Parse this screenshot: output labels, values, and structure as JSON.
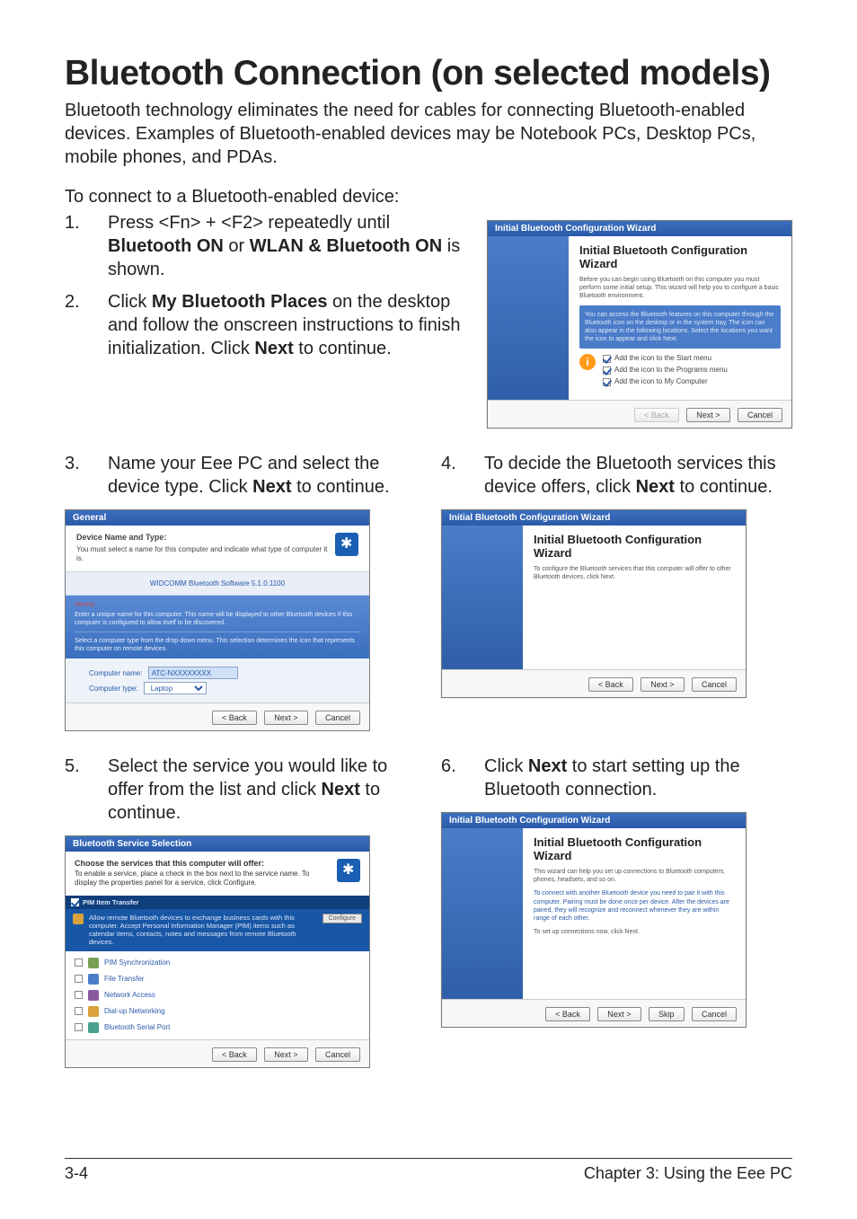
{
  "heading": "Bluetooth Connection (on selected models)",
  "intro": "Bluetooth technology eliminates the need for cables for connecting Bluetooth-enabled devices. Examples of Bluetooth-enabled devices may be Notebook PCs, Desktop PCs, mobile phones, and PDAs.",
  "lead": "To connect to a Bluetooth-enabled device:",
  "steps": {
    "s1_num": "1.",
    "s1_a": "Press <Fn> + <F2> repeatedly until ",
    "s1_b1": "Bluetooth ON",
    "s1_mid": " or ",
    "s1_b2": "WLAN & Bluetooth ON",
    "s1_c": " is shown.",
    "s2_num": "2.",
    "s2_a": "Click ",
    "s2_b": "My Bluetooth Places",
    "s2_c": " on the desktop and follow the onscreen instructions to finish initialization. Click ",
    "s2_d": "Next",
    "s2_e": " to continue.",
    "s3_num": "3.",
    "s3_a": "Name your Eee PC and select the device type. Click ",
    "s3_b": "Next",
    "s3_c": " to continue.",
    "s4_num": "4.",
    "s4_a": "To decide the Bluetooth services this device offers, click ",
    "s4_b": "Next",
    "s4_c": " to continue.",
    "s5_num": "5.",
    "s5_a": "Select the service you would like to offer from the list and click ",
    "s5_b": "Next",
    "s5_c": " to continue.",
    "s6_num": "6.",
    "s6_a": "Click ",
    "s6_b": "Next",
    "s6_c": " to start setting up the Bluetooth connection."
  },
  "wizard": {
    "titlebar": "Initial Bluetooth Configuration Wizard",
    "h": "Initial Bluetooth Configuration Wizard",
    "p1": "Before you can begin using Bluetooth on this computer you must perform some initial setup. This wizard will help you to configure a basic Bluetooth environment.",
    "bluebox": "You can access the Bluetooth features on this computer through the Bluetooth icon on the desktop or in the system tray. The icon can also appear in the following locations. Select the locations you want the icon to appear and click Next.",
    "check1": "Add the icon to the Start menu",
    "check2": "Add the icon to the Programs menu",
    "check3": "Add the icon to My Computer",
    "btn_back": "< Back",
    "btn_next": "Next >",
    "btn_cancel": "Cancel"
  },
  "wizard3": {
    "titlebar": "General",
    "group": "Device Name and Type:",
    "desc": "You must select a name for this computer and indicate what type of computer it is.",
    "section": "WIDCOMM Bluetooth Software 5.1.0.1100",
    "blue1": "Enter a unique name for this computer. This name will be displayed to other Bluetooth devices if this computer is configured to allow itself to be discovered.",
    "blue2": "Select a computer type from the drop-down menu. This selection determines the icon that represents this computer on remote devices.",
    "label_name": "Computer name:",
    "value_name": "ATC-NXXXXXXXX",
    "label_type": "Computer type:",
    "value_type": "Laptop"
  },
  "wizard4": {
    "h": "Initial Bluetooth Configuration Wizard",
    "p": "To configure the Bluetooth services that this computer will offer to other Bluetooth devices, click Next."
  },
  "wizard5": {
    "titlebar": "Bluetooth Service Selection",
    "bb": "Choose the services that this computer will offer:",
    "desc": "To enable a service, place a check in the box next to the service name. To display the properties panel for a service, click Configure.",
    "panel_hdr": "PIM Item Transfer",
    "panel_txt": "Allow remote Bluetooth devices to exchange business cards with this computer. Accept Personal Information Manager (PIM) items such as calendar items, contacts, notes and messages from remote Bluetooth devices.",
    "cfg": "Configure",
    "items": [
      "PIM Synchronization",
      "File Transfer",
      "Network Access",
      "Dial-up Networking",
      "Bluetooth Serial Port"
    ]
  },
  "wizard6": {
    "h": "Initial Bluetooth Configuration Wizard",
    "p1": "This wizard can help you set up connections to Bluetooth computers, phones, headsets, and so on.",
    "p2": "To connect with another Bluetooth device you need to pair it with this computer. Pairing must be done once per device. After the devices are paired, they will recognize and reconnect whenever they are within range of each other.",
    "p3": "To set up connections now, click Next."
  },
  "footer": {
    "left": "3-4",
    "right": "Chapter 3:  Using the Eee PC"
  }
}
